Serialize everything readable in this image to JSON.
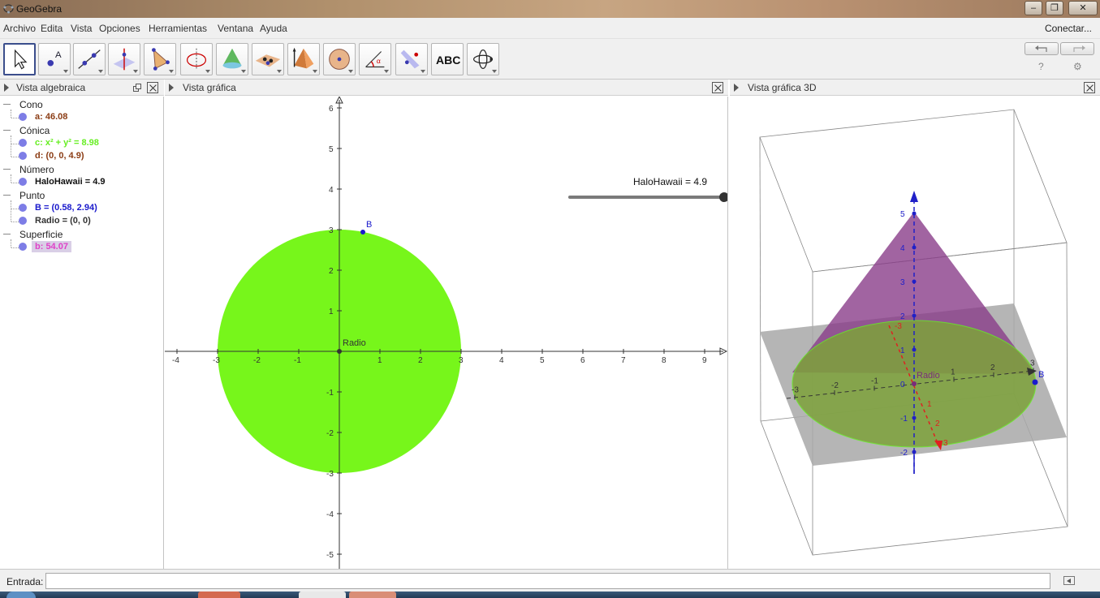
{
  "window": {
    "title": "GeoGebra"
  },
  "menu": {
    "items": [
      "Archivo",
      "Edita",
      "Vista",
      "Opciones",
      "Herramientas",
      "Ventana",
      "Ayuda"
    ],
    "connect": "Conectar..."
  },
  "toolbar": {
    "text_tool_label": "ABC",
    "help_icon": "?",
    "settings_icon": "⚙"
  },
  "panels": {
    "algebra_title": "Vista algebraica",
    "graphics_title": "Vista gráfica",
    "graphics3d_title": "Vista gráfica 3D"
  },
  "algebra": {
    "categories": [
      "Cono",
      "Cónica",
      "Número",
      "Punto",
      "Superficie"
    ],
    "entries": [
      {
        "text": "a: 46.08",
        "color": "#8b3c14"
      },
      {
        "text": "c: x² + y² = 8.98",
        "color": "#66ee22"
      },
      {
        "text": "d: (0, 0, 4.9)",
        "color": "#8b3c14"
      },
      {
        "text": "HaloHawaii = 4.9",
        "color": "#111111"
      },
      {
        "text": "B = (0.58, 2.94)",
        "color": "#1a1acc"
      },
      {
        "text": "Radio = (0, 0)",
        "color": "#333333"
      },
      {
        "text": "b: 54.07",
        "color": "#e040c8"
      }
    ]
  },
  "graphics": {
    "slider_label": "HaloHawaii = 4.9",
    "point_B_label": "B",
    "origin_label": "Radio",
    "x_ticks": [
      "-4",
      "-3",
      "-2",
      "-1",
      "1",
      "2",
      "3",
      "4",
      "5",
      "6",
      "7",
      "8",
      "9"
    ],
    "y_ticks": [
      "6",
      "5",
      "4",
      "3",
      "2",
      "1",
      "-1",
      "-2",
      "-3",
      "-4",
      "-5"
    ],
    "circle_color": "#73f614"
  },
  "graphics3d": {
    "z_ticks": [
      "5",
      "4",
      "3",
      "2",
      "1",
      "0",
      "-1",
      "-2"
    ],
    "x_ticks": [
      "-3",
      "-2",
      "-1",
      "1",
      "2",
      "3"
    ],
    "y_ticks": [
      "-3",
      "1",
      "2",
      "3"
    ],
    "origin_label": "Radio",
    "point_B_label": "B",
    "cone_color": "#8a3d8a",
    "base_color": "#7da23a"
  },
  "inputbar": {
    "label": "Entrada:",
    "value": ""
  }
}
